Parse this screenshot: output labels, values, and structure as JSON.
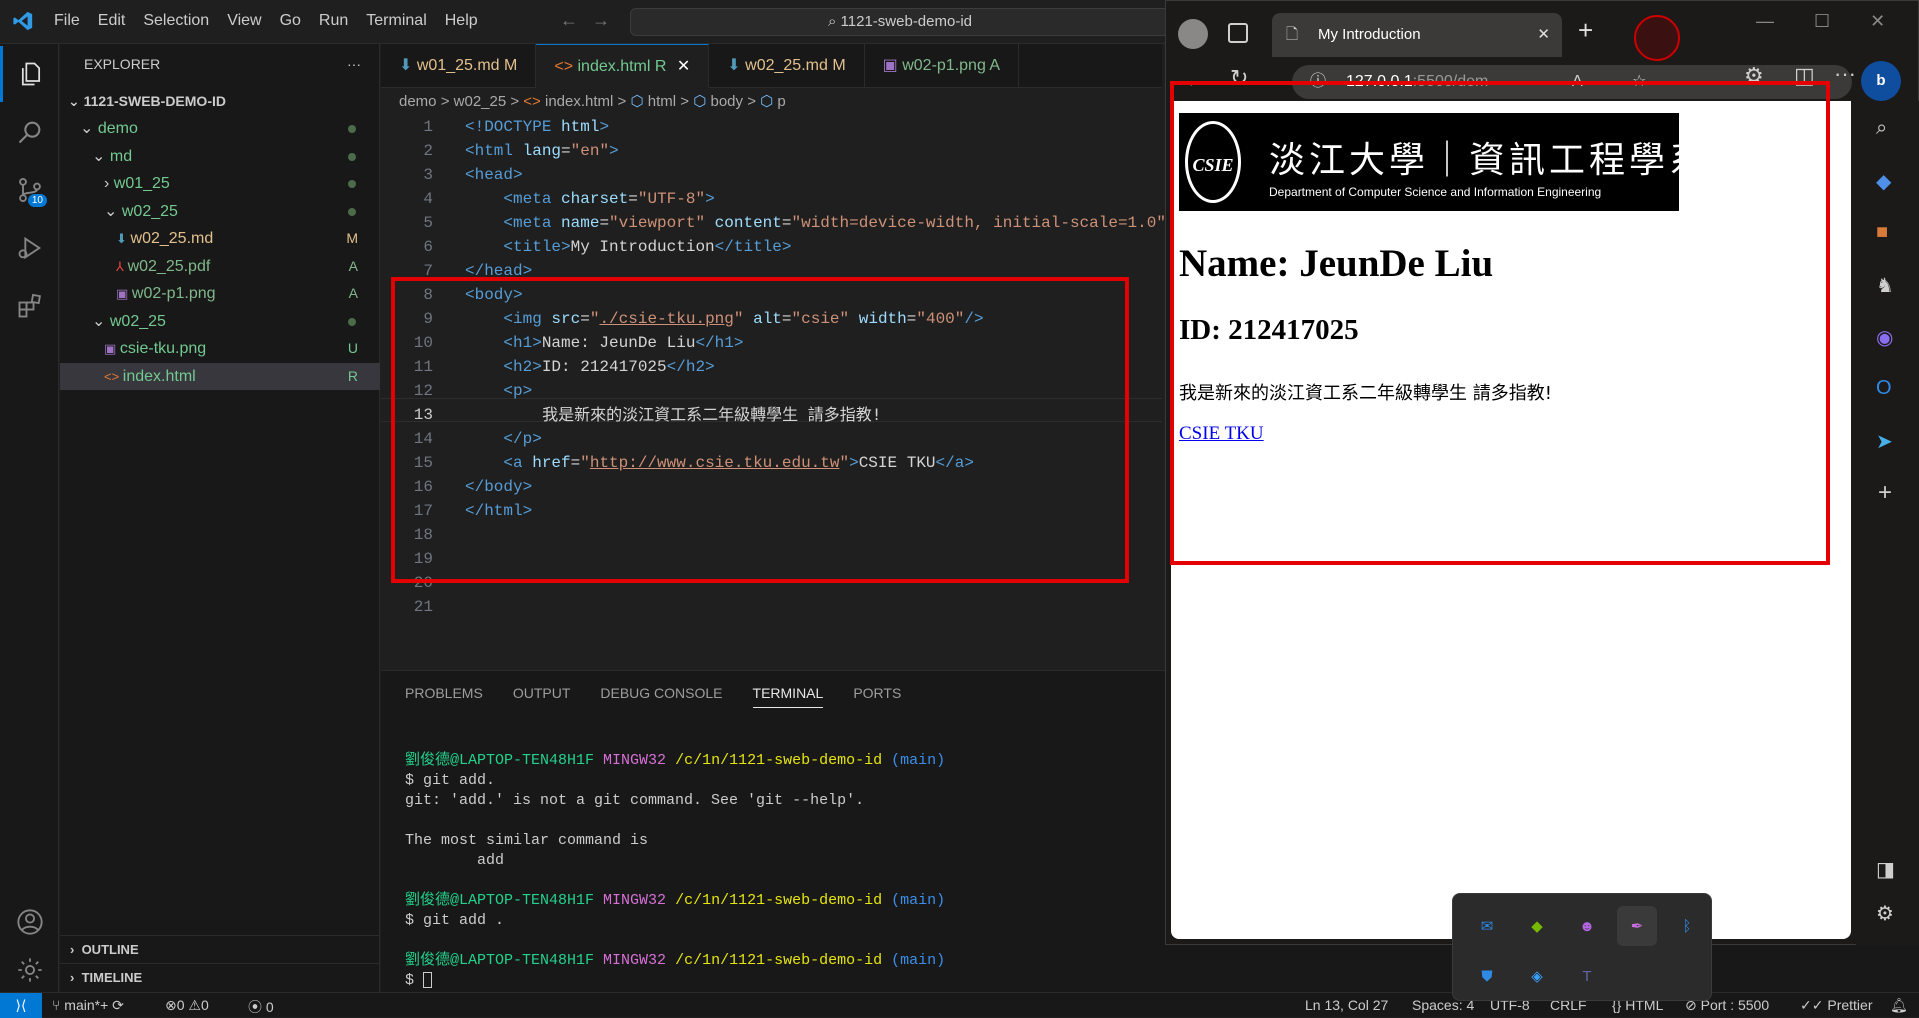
{
  "window": {
    "menu": [
      "File",
      "Edit",
      "Selection",
      "View",
      "Go",
      "Run",
      "Terminal",
      "Help"
    ],
    "search_text": "1121-sweb-demo-id"
  },
  "activity": {
    "source_control_badge": "10"
  },
  "explorer": {
    "title": "EXPLORER",
    "more": "···",
    "root": "1121-SWEB-DEMO-ID",
    "items": [
      {
        "label": "demo",
        "status": "",
        "indent": 1,
        "chev": "v",
        "color": "#73c991"
      },
      {
        "label": "md",
        "status": "",
        "indent": 2,
        "chev": "v",
        "color": "#73c991"
      },
      {
        "label": "w01_25",
        "status": "",
        "indent": 3,
        "chev": ">",
        "color": "#73c991"
      },
      {
        "label": "w02_25",
        "status": "",
        "indent": 3,
        "chev": "v",
        "color": "#73c991"
      },
      {
        "label": "w02_25.md",
        "status": "M",
        "indent": 4,
        "chev": "",
        "color": "#e2c08d"
      },
      {
        "label": "w02_25.pdf",
        "status": "A",
        "indent": 4,
        "chev": "",
        "color": "#81b88b"
      },
      {
        "label": "w02-p1.png",
        "status": "A",
        "indent": 4,
        "chev": "",
        "color": "#81b88b"
      },
      {
        "label": "w02_25",
        "status": "",
        "indent": 2,
        "chev": "v",
        "color": "#73c991"
      },
      {
        "label": "csie-tku.png",
        "status": "U",
        "indent": 3,
        "chev": "",
        "color": "#73c991"
      },
      {
        "label": "index.html",
        "status": "R",
        "indent": 3,
        "chev": "",
        "color": "#73c991"
      }
    ],
    "outline": "OUTLINE",
    "timeline": "TIMELINE"
  },
  "tabs": [
    {
      "label": "w01_25.md",
      "status": "M",
      "color": "#e2c08d"
    },
    {
      "label": "index.html",
      "status": "R",
      "color": "#73c991"
    },
    {
      "label": "w02_25.md",
      "status": "M",
      "color": "#e2c08d"
    },
    {
      "label": "w02-p1.png",
      "status": "A",
      "color": "#81b88b"
    }
  ],
  "breadcrumb": [
    "demo",
    ">",
    "w02_25",
    ">",
    "index.html",
    ">",
    "html",
    ">",
    "body",
    ">",
    "p"
  ],
  "code": {
    "line_numbers": [
      "1",
      "2",
      "3",
      "4",
      "5",
      "6",
      "7",
      "8",
      "9",
      "10",
      "11",
      "12",
      "13",
      "14",
      "15",
      "16",
      "17",
      "18",
      "19",
      "20",
      "21"
    ],
    "current_line": "13",
    "l13_text": "我是新來的淡江資工系二年級轉學生 請多指教!"
  },
  "panel": {
    "tabs": [
      "PROBLEMS",
      "OUTPUT",
      "DEBUG CONSOLE",
      "TERMINAL",
      "PORTS"
    ],
    "active": "TERMINAL",
    "prompt_user": "劉俊德@LAPTOP-TEN48H1F",
    "prompt_env": "MINGW32",
    "prompt_path": "/c/1n/1121-sweb-demo-id",
    "prompt_branch": "(main)",
    "lines": [
      "$ git add.",
      "git: 'add.' is not a git command. See 'git --help'.",
      "",
      "The most similar command is",
      "        add"
    ],
    "cmd2": "$ git add .",
    "cmd3": "$ "
  },
  "status": {
    "branch": "main*+",
    "errors": "0",
    "warnings": "0",
    "ports": "0",
    "position": "Ln 13, Col 27",
    "spaces": "Spaces: 4",
    "encoding": "UTF-8",
    "eol": "CRLF",
    "lang": "HTML",
    "port": "Port : 5500",
    "prettier": "Prettier"
  },
  "browser": {
    "tab_title": "My Introduction",
    "url_host": "127.0.0.1",
    "url_rest": ":5500/dem",
    "logo_cn": "淡江大學｜資訊工程學系",
    "logo_en": "Department of Computer Science and Information Engineering",
    "logo_mark": "CSIE",
    "h1": "Name: JeunDe Liu",
    "h2": "ID: 212417025",
    "p": "我是新來的淡江資工系二年級轉學生 請多指教!",
    "link": "CSIE TKU"
  },
  "colors": {
    "accent": "#0078d4",
    "highlight_box": "#e50000"
  }
}
